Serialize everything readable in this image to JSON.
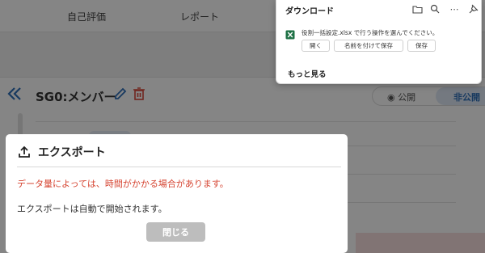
{
  "topnav": {
    "items": [
      "自己評価",
      "レポート"
    ]
  },
  "page": {
    "title": "SG0:メンバー",
    "visibility": {
      "public_label": "公開",
      "private_label": "非公開"
    }
  },
  "export_dialog": {
    "title": "エクスポート",
    "warning": "データ量によっては、時間がかかる場合があります。",
    "info": "エクスポートは自動で開始されます。",
    "close_label": "閉じる"
  },
  "download_panel": {
    "title": "ダウンロード",
    "icons": [
      "folder-icon",
      "search-icon",
      "more-icon",
      "pin-icon"
    ],
    "message": "役割一括設定.xlsx で行う操作を選んでください。",
    "actions": [
      "開く",
      "名前を付けて保存",
      "保存"
    ],
    "more_label": "もっと見る"
  },
  "colors": {
    "accent": "#2f6fb8",
    "warning": "#d64532",
    "delete": "#d94a3d",
    "excel": "#1e7145",
    "disabled_button": "#bdbdbd"
  }
}
